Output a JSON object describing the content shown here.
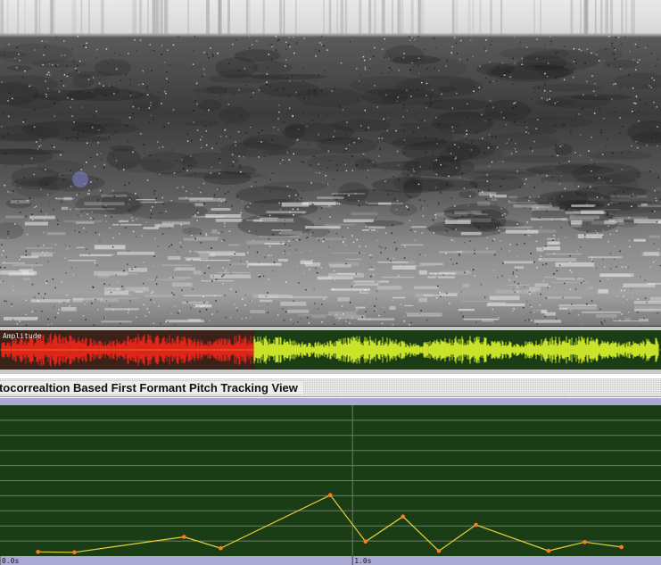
{
  "waveform": {
    "label": "Amplitude",
    "colors": {
      "background": "#1b3d16",
      "played": "#e0241a",
      "unplayed": "#c9e22a",
      "played_background": "#3a2218"
    },
    "playhead_fraction": 0.385
  },
  "pitch_view": {
    "title": "utocorrealtion Based First Formant Pitch Tracking View",
    "colors": {
      "background": "#1b3d16",
      "grid": "#6b7f63",
      "line": "#e6d23a",
      "point": "#ff7a1a",
      "axis_strip": "#aaa8d4"
    },
    "time_labels": [
      {
        "label": "0.0s",
        "t": 0.0
      },
      {
        "label": "1.0s",
        "t": 1.0
      }
    ],
    "x_range": [
      0.0,
      1.875
    ],
    "y_range": [
      0,
      1
    ],
    "points": [
      {
        "t": 0.108,
        "v": 0.028
      },
      {
        "t": 0.211,
        "v": 0.025
      },
      {
        "t": 0.522,
        "v": 0.127
      },
      {
        "t": 0.626,
        "v": 0.052
      },
      {
        "t": 0.937,
        "v": 0.404
      },
      {
        "t": 1.037,
        "v": 0.096
      },
      {
        "t": 1.143,
        "v": 0.262
      },
      {
        "t": 1.245,
        "v": 0.034
      },
      {
        "t": 1.35,
        "v": 0.207
      },
      {
        "t": 1.556,
        "v": 0.035
      },
      {
        "t": 1.659,
        "v": 0.093
      },
      {
        "t": 1.763,
        "v": 0.06
      }
    ]
  }
}
